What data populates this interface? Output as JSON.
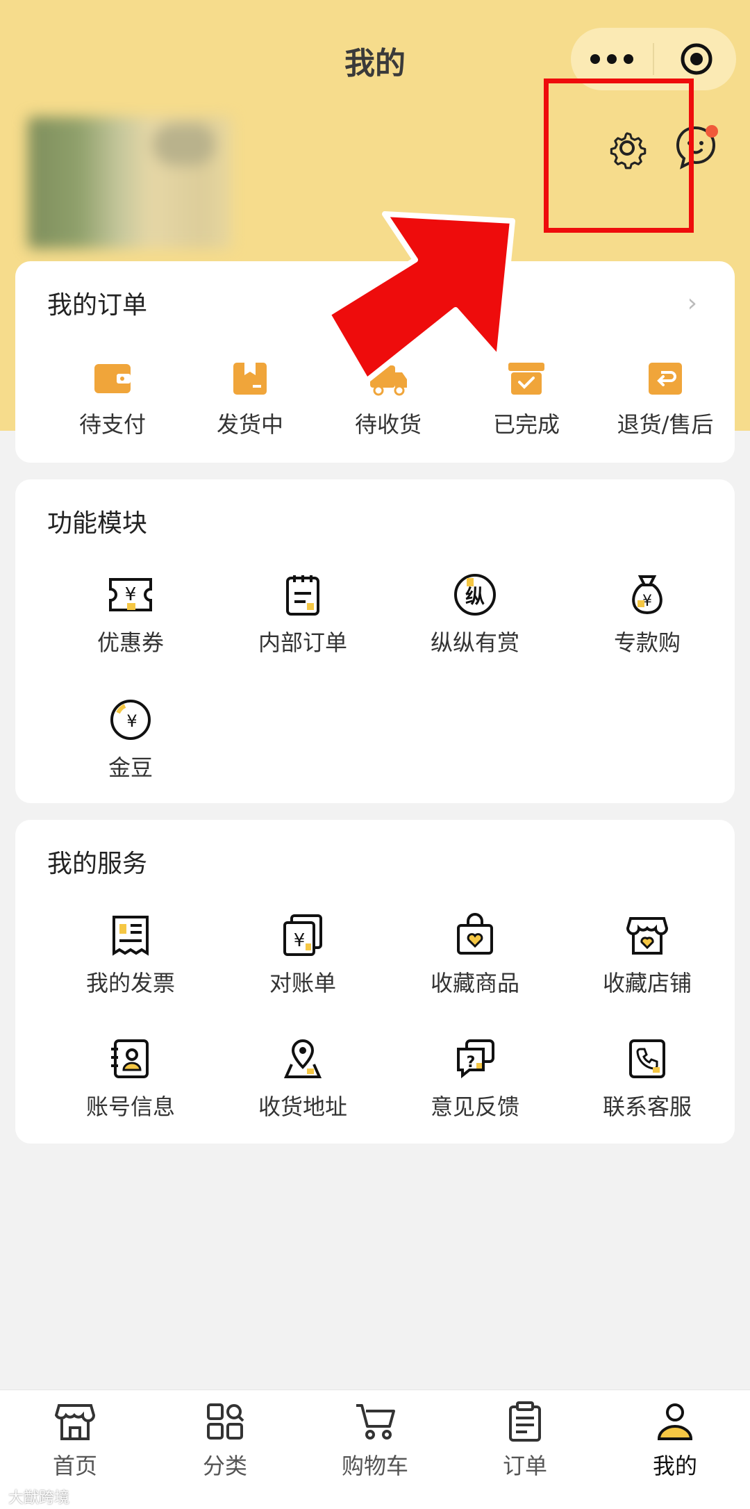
{
  "header": {
    "title": "我的"
  },
  "orders": {
    "title": "我的订单",
    "items": [
      {
        "label": "待支付",
        "icon": "wallet-icon"
      },
      {
        "label": "发货中",
        "icon": "package-icon"
      },
      {
        "label": "待收货",
        "icon": "delivery-truck-icon"
      },
      {
        "label": "已完成",
        "icon": "completed-box-icon"
      },
      {
        "label": "退货/售后",
        "icon": "return-box-icon"
      }
    ]
  },
  "features": {
    "title": "功能模块",
    "items": [
      {
        "label": "优惠券",
        "icon": "coupon-icon"
      },
      {
        "label": "内部订单",
        "icon": "notepad-icon"
      },
      {
        "label": "纵纵有赏",
        "icon": "zong-reward-icon"
      },
      {
        "label": "专款购",
        "icon": "money-bag-icon"
      },
      {
        "label": "金豆",
        "icon": "gold-bean-icon"
      }
    ]
  },
  "services": {
    "title": "我的服务",
    "items": [
      {
        "label": "我的发票",
        "icon": "invoice-icon"
      },
      {
        "label": "对账单",
        "icon": "statement-icon"
      },
      {
        "label": "收藏商品",
        "icon": "favorite-goods-icon"
      },
      {
        "label": "收藏店铺",
        "icon": "favorite-store-icon"
      },
      {
        "label": "账号信息",
        "icon": "account-info-icon"
      },
      {
        "label": "收货地址",
        "icon": "address-pin-icon"
      },
      {
        "label": "意见反馈",
        "icon": "feedback-icon"
      },
      {
        "label": "联系客服",
        "icon": "phone-service-icon"
      }
    ]
  },
  "tabbar": {
    "items": [
      {
        "label": "首页",
        "icon": "store-icon"
      },
      {
        "label": "分类",
        "icon": "category-icon"
      },
      {
        "label": "购物车",
        "icon": "cart-icon"
      },
      {
        "label": "订单",
        "icon": "clipboard-icon"
      },
      {
        "label": "我的",
        "icon": "user-icon",
        "active": true
      }
    ]
  },
  "watermark": "大猷跨境",
  "colors": {
    "header_bg": "#f6dc8c",
    "accent_orange": "#f0a53a",
    "accent_yellow": "#f5c744",
    "highlight_red": "#ee0c0c",
    "badge_red": "#f05a3a"
  }
}
